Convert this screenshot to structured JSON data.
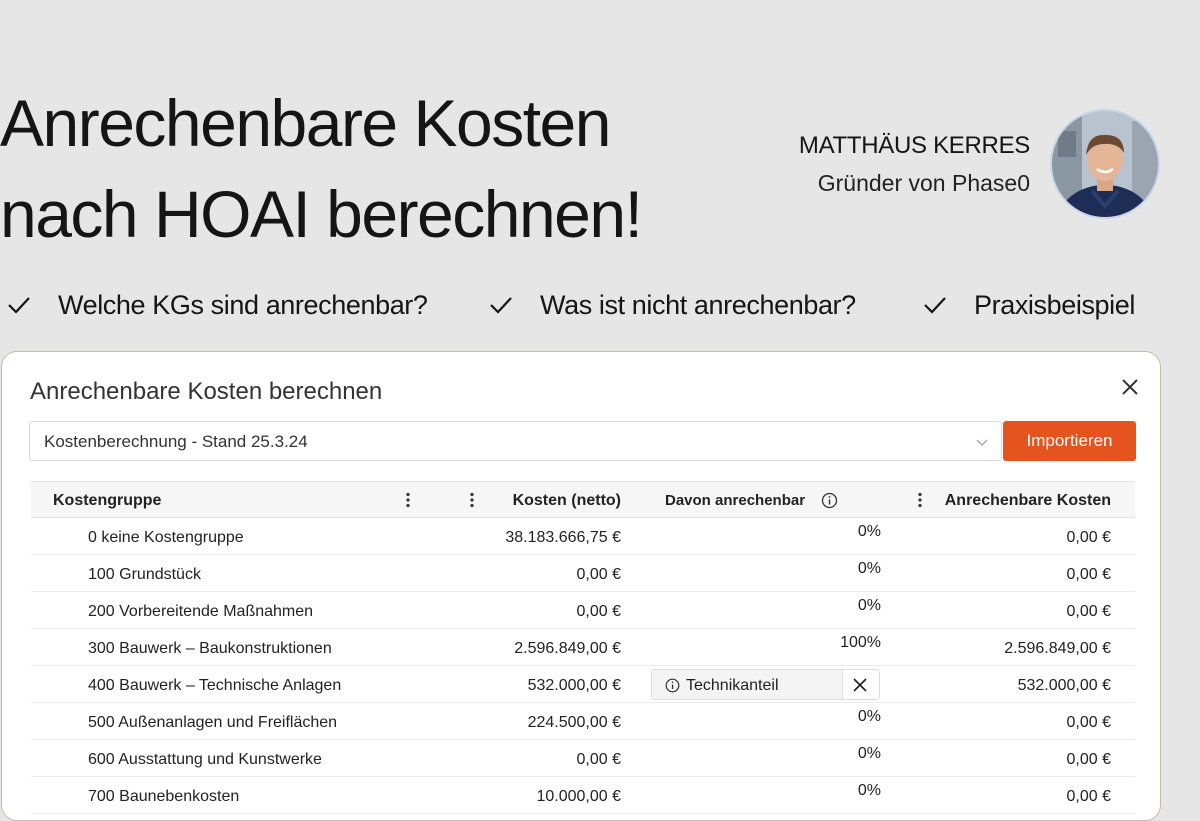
{
  "headline": {
    "line1": "Anrechenbare Kosten",
    "line2": "nach HOAI berechnen!"
  },
  "author": {
    "name": "MATTHÄUS KERRES",
    "role": "Gründer von Phase0"
  },
  "features": [
    "Welche KGs sind anrechenbar?",
    "Was ist nicht anrechenbar?",
    "Praxisbeispiel"
  ],
  "dialog": {
    "title": "Anrechenbare Kosten berechnen",
    "select_value": "Kostenberechnung - Stand 25.3.24",
    "import_label": "Importieren",
    "columns": {
      "kostengruppe": "Kostengruppe",
      "kosten": "Kosten (netto)",
      "davon": "Davon anrechenbar",
      "anrechenbar": "Anrechenbare Kosten"
    },
    "rows": [
      {
        "name": "0 keine Kostengruppe",
        "cost": "38.183.666,75 €",
        "pct": "0%",
        "anr": "0,00 €"
      },
      {
        "name": "100 Grundstück",
        "cost": "0,00 €",
        "pct": "0%",
        "anr": "0,00 €"
      },
      {
        "name": "200 Vorbereitende Maßnahmen",
        "cost": "0,00 €",
        "pct": "0%",
        "anr": "0,00 €"
      },
      {
        "name": "300 Bauwerk – Baukonstruktionen",
        "cost": "2.596.849,00 €",
        "pct": "100%",
        "anr": "2.596.849,00 €"
      },
      {
        "name": "400 Bauwerk – Technische Anlagen",
        "cost": "532.000,00 €",
        "chip": "Technikanteil",
        "anr": "532.000,00 €"
      },
      {
        "name": "500 Außenanlagen und Freiflächen",
        "cost": "224.500,00 €",
        "pct": "0%",
        "anr": "0,00 €"
      },
      {
        "name": "600 Ausstattung und Kunstwerke",
        "cost": "0,00 €",
        "pct": "0%",
        "anr": "0,00 €"
      },
      {
        "name": "700 Baunebenkosten",
        "cost": "10.000,00 €",
        "pct": "0%",
        "anr": "0,00 €"
      }
    ]
  },
  "colors": {
    "accent": "#e5531f",
    "background": "#e6e6e6",
    "dialog_border": "#c9bda6"
  },
  "icons": {
    "feature": "check-icon",
    "close": "close-icon",
    "info": "info-icon",
    "menu": "kebab-icon"
  }
}
